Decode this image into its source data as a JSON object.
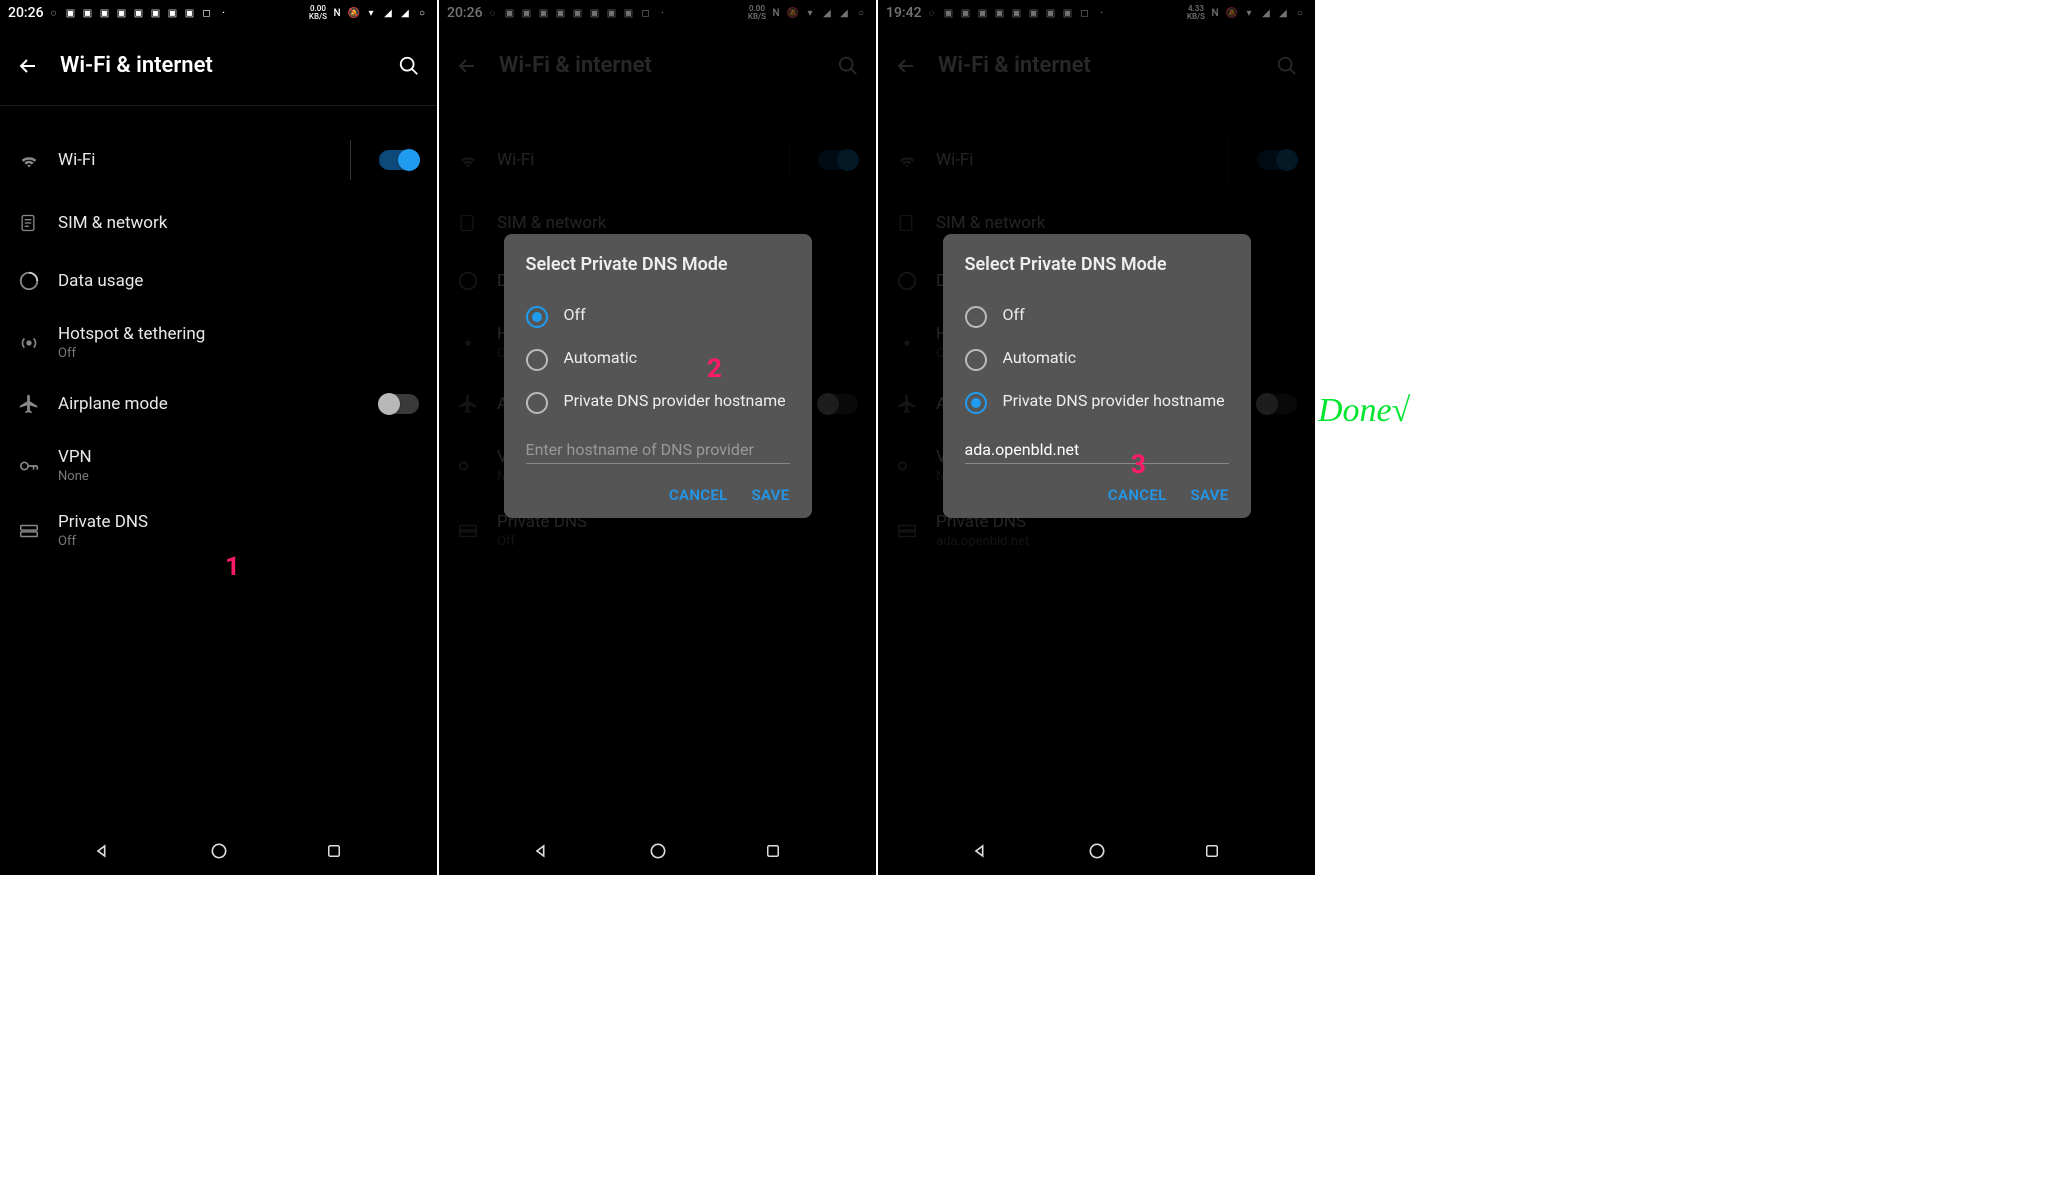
{
  "screens": [
    {
      "time": "20:26",
      "kbs": "0.00",
      "kbs_unit": "KB/S",
      "header": "Wi-Fi & internet",
      "private_dns_sub": "Off",
      "annotation": "1"
    },
    {
      "time": "20:26",
      "kbs": "0.00",
      "kbs_unit": "KB/S",
      "header": "Wi-Fi & internet",
      "private_dns_sub": "Off",
      "dialog_selected": "off",
      "dialog_input": "",
      "annotation": "2"
    },
    {
      "time": "19:42",
      "kbs": "4.33",
      "kbs_unit": "KB/S",
      "header": "Wi-Fi & internet",
      "private_dns_sub": "ada.openbld.net",
      "dialog_selected": "hostname",
      "dialog_input": "ada.openbld.net",
      "annotation": "3"
    }
  ],
  "rows": {
    "wifi": "Wi-Fi",
    "sim": "SIM & network",
    "data": "Data usage",
    "hotspot": "Hotspot & tethering",
    "hotspot_sub": "Off",
    "airplane": "Airplane mode",
    "vpn": "VPN",
    "vpn_sub": "None",
    "private_dns": "Private DNS"
  },
  "dialog": {
    "title": "Select Private DNS Mode",
    "opt_off": "Off",
    "opt_auto": "Automatic",
    "opt_hostname": "Private DNS provider hostname",
    "placeholder": "Enter hostname of DNS provider",
    "cancel": "CANCEL",
    "save": "SAVE"
  },
  "done_label": "Done√"
}
